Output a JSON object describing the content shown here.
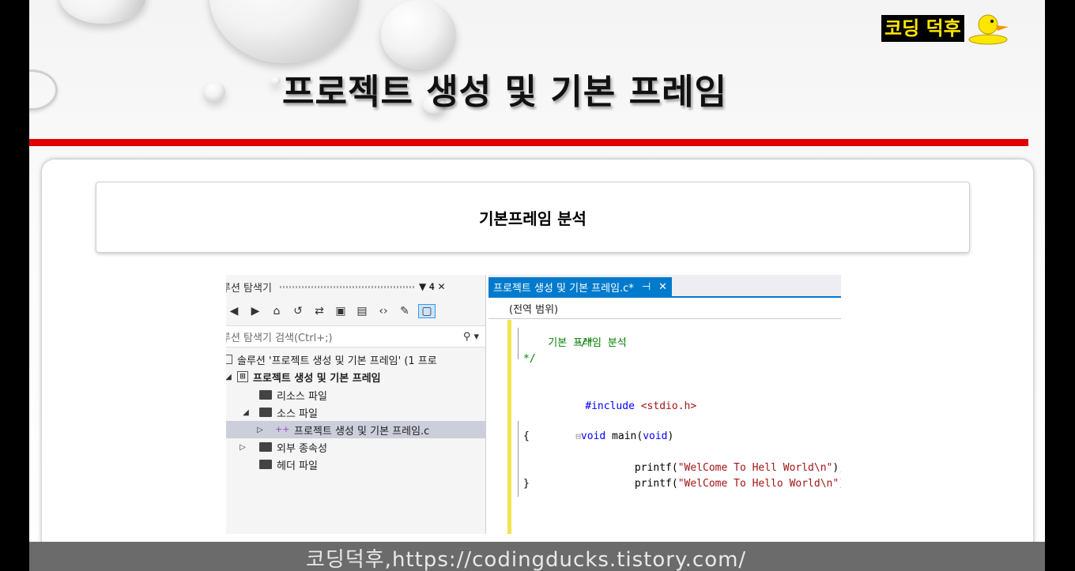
{
  "slide": {
    "title": "프로젝트 생성 및 기본 프레임",
    "logo_text": "코딩 덕후",
    "heading": "기본프레임 분석",
    "footer": "코딩덕후,https://codingducks.tistory.com/"
  },
  "solution_explorer": {
    "title": "루션 탐색기",
    "controls": "▼ 𝟒 ✕",
    "search_placeholder": "루션 탐색기 검색(Ctrl+;)",
    "search_icon": "search-icon",
    "toolbar_icons": [
      "back-icon",
      "forward-icon",
      "home-icon",
      "history-icon",
      "sync-icon",
      "collapse-icon",
      "show-all-icon",
      "code-icon",
      "wrench-icon",
      "preview-icon"
    ],
    "tree": [
      {
        "label": "솔루션 '프로젝트 생성 및 기본 프레임' (1 프로",
        "icon": "solution-icon",
        "arrow": ""
      },
      {
        "label": "프로젝트 생성 및 기본 프레임",
        "icon": "project-icon",
        "arrow": "◢"
      },
      {
        "label": "리소스 파일",
        "icon": "folder-icon",
        "arrow": ""
      },
      {
        "label": "소스 파일",
        "icon": "folder-icon",
        "arrow": "◢"
      },
      {
        "label": "프로젝트 생성 및 기본 프레임.c",
        "icon": "c-file-icon",
        "arrow": "▷"
      },
      {
        "label": "외부 종속성",
        "icon": "folder-icon",
        "arrow": "▷"
      },
      {
        "label": "헤더 파일",
        "icon": "folder-icon",
        "arrow": ""
      }
    ]
  },
  "editor": {
    "tab_label": "프로젝트 생성 및 기본 프레임.c*",
    "tab_pin": "⊣",
    "tab_close": "✕",
    "scope": "(전역 범위)",
    "code": {
      "l1": "/*",
      "l2": "    기본 프레임 분석",
      "l3": "*/",
      "l5a": "#include ",
      "l5b": "<stdio.h>",
      "l7a": "void",
      "l7b": " main(",
      "l7c": "void",
      "l7d": ")",
      "l8": "{",
      "l9a": "        printf(",
      "l9b": "\"WelCome To Hell World\\n\"",
      "l9c": ");",
      "l10a": "        printf(",
      "l10b": "\"WelCome To Hello World\\n\"",
      "l10c": ");",
      "l11": "}"
    }
  }
}
